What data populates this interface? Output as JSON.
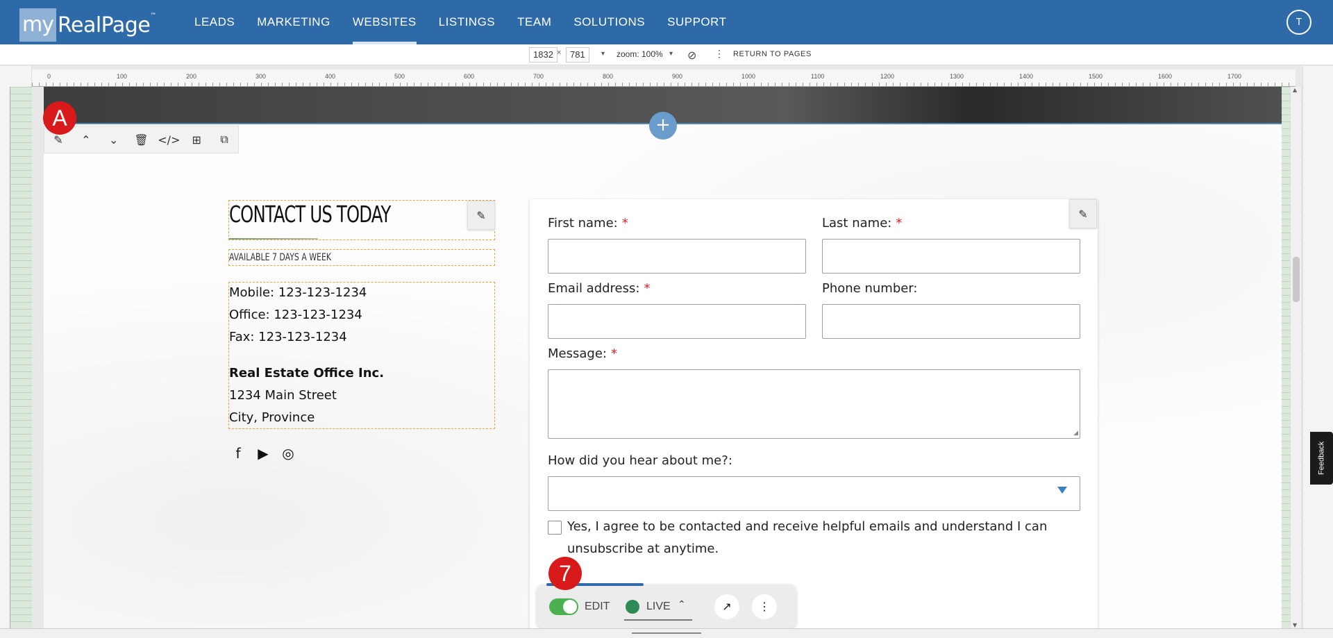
{
  "brand": {
    "my": "my",
    "name": "RealPage",
    "tm": "™"
  },
  "nav": {
    "items": [
      {
        "label": "LEADS"
      },
      {
        "label": "MARKETING"
      },
      {
        "label": "WEBSITES",
        "active": true
      },
      {
        "label": "LISTINGS"
      },
      {
        "label": "TEAM"
      },
      {
        "label": "SOLUTIONS"
      },
      {
        "label": "SUPPORT"
      }
    ],
    "avatar_initial": "T"
  },
  "toolbar": {
    "width": "1832",
    "times": "×",
    "height": "781",
    "zoom": "zoom: 100%",
    "return_label": "RETURN TO PAGES"
  },
  "ruler": {
    "ticks": [
      "0",
      "100",
      "200",
      "300",
      "400",
      "500",
      "600",
      "700",
      "800",
      "900",
      "1000",
      "1100",
      "1200",
      "1300",
      "1400",
      "1500",
      "1600",
      "1700"
    ]
  },
  "badges": {
    "section": "A",
    "step": "7"
  },
  "contact": {
    "heading": "CONTACT US TODAY",
    "subheading": "AVAILABLE 7 DAYS A WEEK",
    "mobile": "Mobile: 123-123-1234",
    "office": "Office: 123-123-1234",
    "fax": "Fax: 123-123-1234",
    "company": "Real Estate Office Inc.",
    "street": "1234 Main Street",
    "city": "City, Province",
    "social_icons": [
      "facebook-icon",
      "youtube-icon",
      "instagram-icon"
    ]
  },
  "form": {
    "first_name_label": "First name:",
    "last_name_label": "Last name:",
    "email_label": "Email address:",
    "phone_label": "Phone number:",
    "message_label": "Message:",
    "hear_label": "How did you hear about me?:",
    "required_mark": "*",
    "agree_text": "Yes, I agree to be contacted and receive helpful emails and understand I can unsubscribe at anytime.",
    "first_name_value": "",
    "last_name_value": "",
    "email_value": "",
    "phone_value": "",
    "message_value": "",
    "hear_value": ""
  },
  "floatbar": {
    "edit_label": "EDIT",
    "live_label": "LIVE"
  },
  "feedback_label": "Feedback",
  "colors": {
    "nav": "#2f6aa8",
    "badge": "#d91a1a",
    "toggle": "#4caf50",
    "dashed_outline": "#f0a23a"
  }
}
